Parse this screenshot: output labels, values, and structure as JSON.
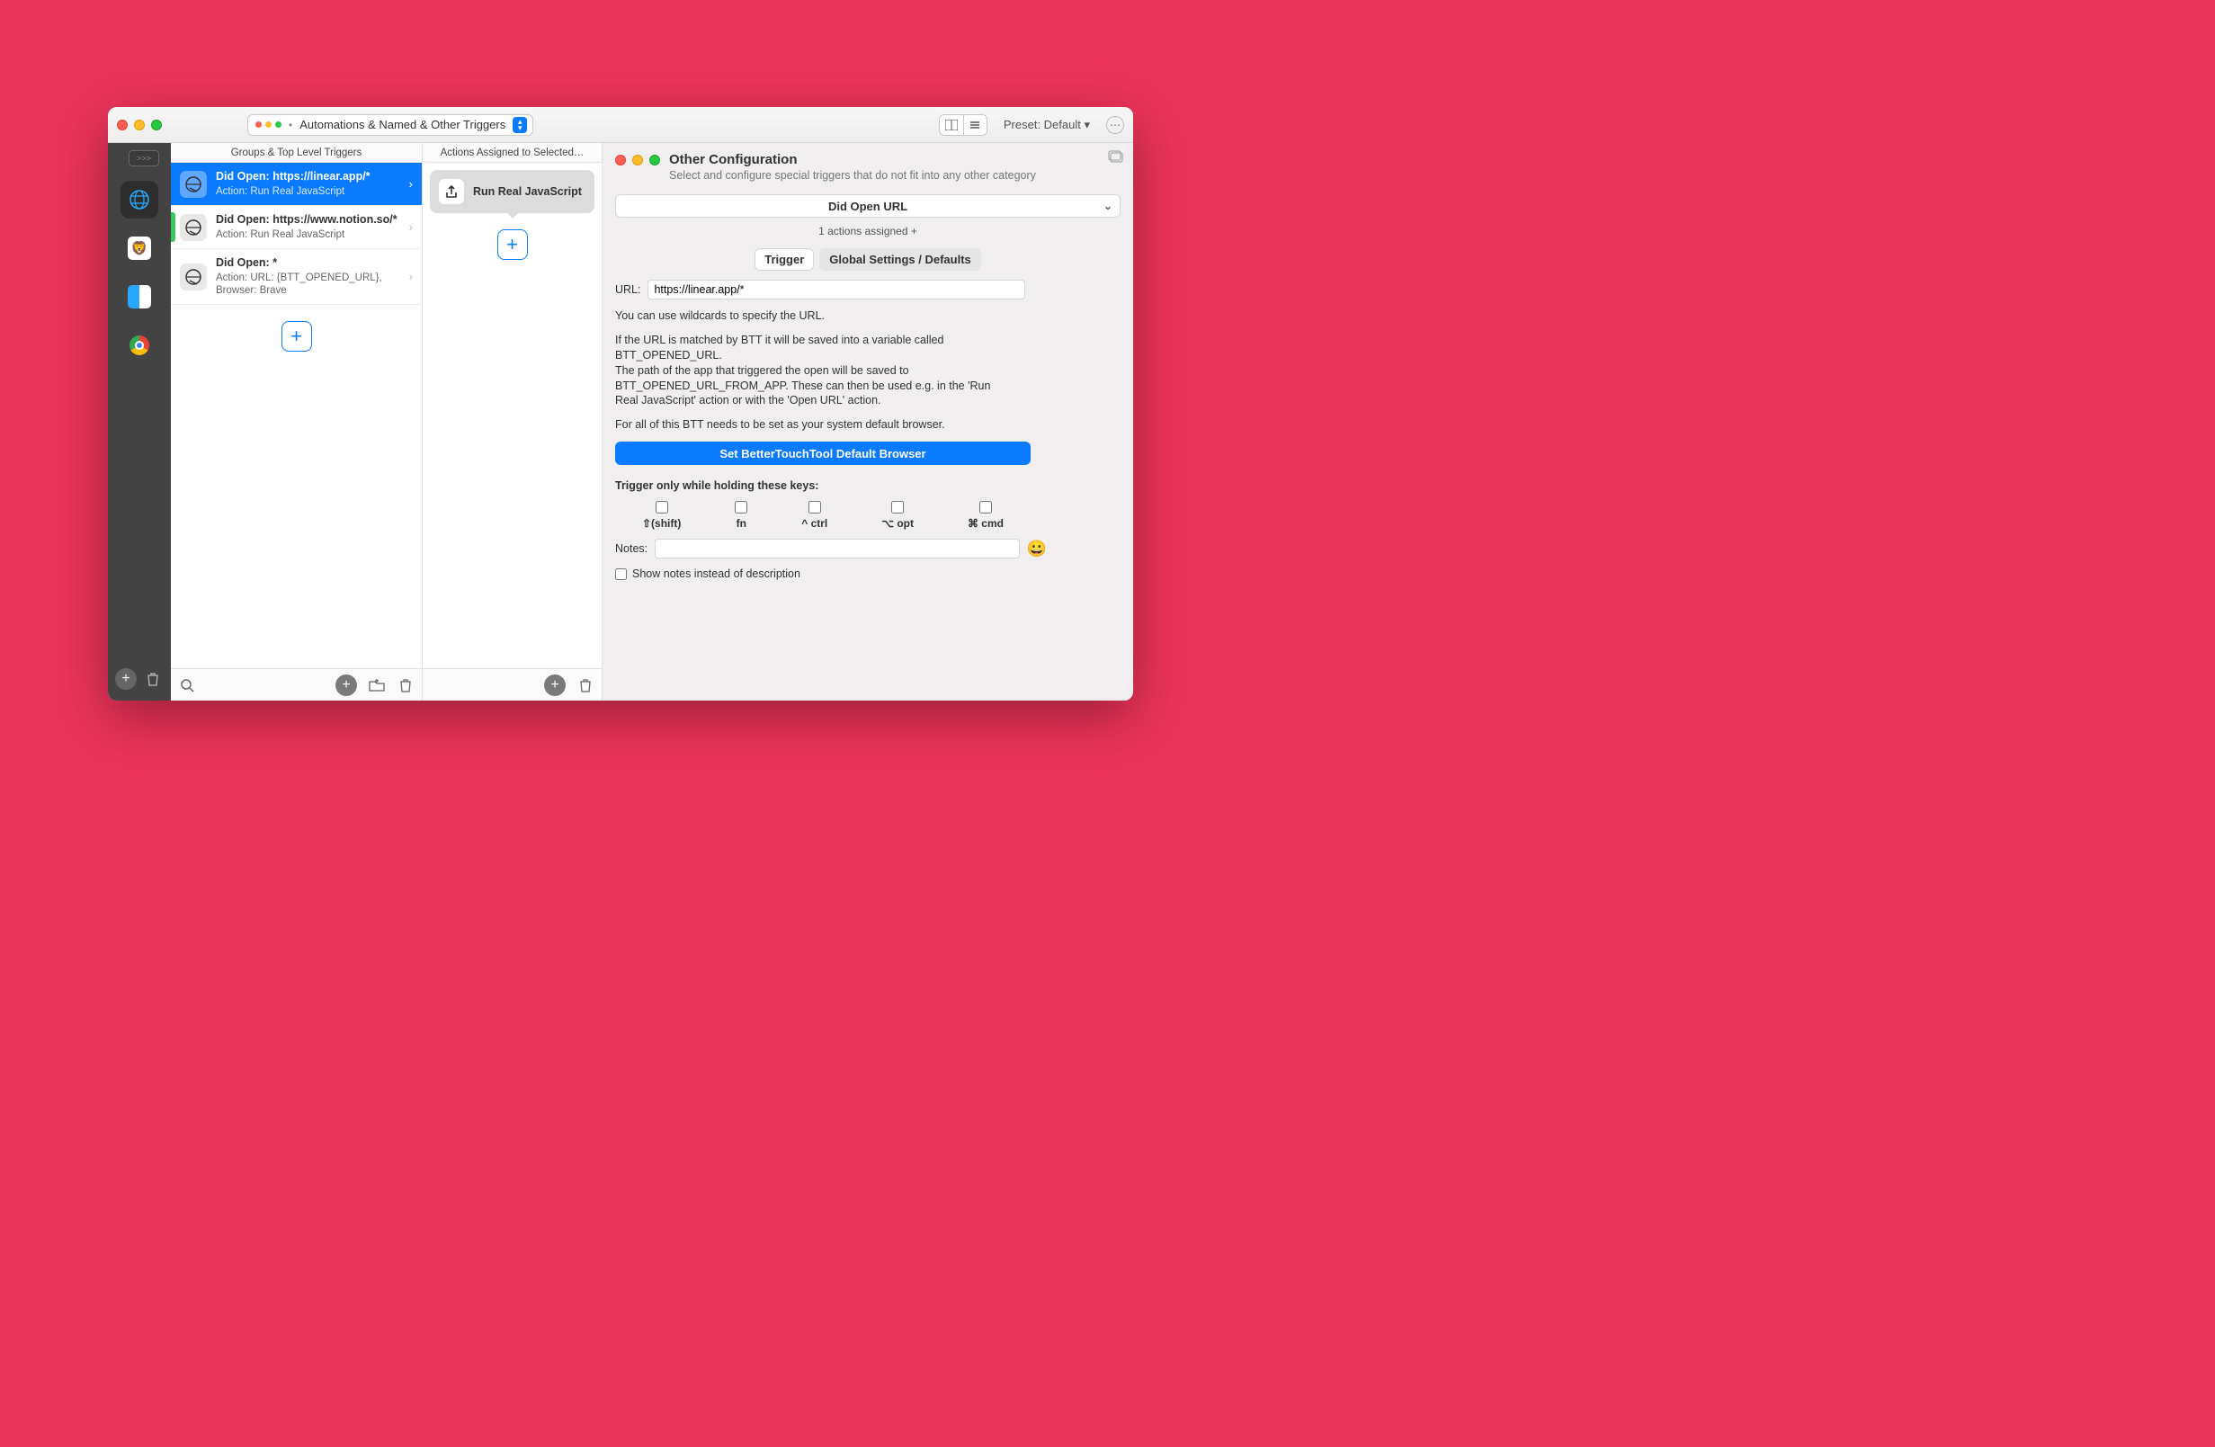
{
  "titlebar": {
    "context_label": "Automations & Named & Other Triggers",
    "preset_label": "Preset: Default ▾"
  },
  "sidebar": {
    "apps": [
      {
        "name": "global-globe",
        "selected": true
      },
      {
        "name": "brave"
      },
      {
        "name": "finder"
      },
      {
        "name": "chrome"
      }
    ]
  },
  "columns": {
    "triggers_header": "Groups & Top Level Triggers",
    "actions_header": "Actions Assigned to Selected…",
    "triggers": [
      {
        "title": "Did Open: https://linear.app/*",
        "sub": "Action: Run Real JavaScript",
        "selected": true
      },
      {
        "title": "Did Open: https://www.notion.so/*",
        "sub": "Action: Run Real JavaScript",
        "green": true
      },
      {
        "title": "Did Open: *",
        "sub": "Action: URL: {BTT_OPENED_URL}, Browser: Brave"
      }
    ],
    "actions": [
      {
        "label": "Run Real JavaScript"
      }
    ]
  },
  "config": {
    "title": "Other Configuration",
    "subtitle": "Select and configure special triggers that do not  fit into any other category",
    "select_value": "Did Open URL",
    "actions_line": "1 actions assigned +",
    "tabs": {
      "trigger": "Trigger",
      "globals": "Global Settings / Defaults"
    },
    "url_label": "URL:",
    "url_value": "https://linear.app/*",
    "explain1": "You can use wildcards to specify the URL.",
    "explain2": "If the URL is matched by BTT it will be saved into a variable called BTT_OPENED_URL.",
    "explain3": "The path of the app that triggered the open will be saved to BTT_OPENED_URL_FROM_APP. These can then be used e.g. in the 'Run Real JavaScript' action or with the 'Open URL' action.",
    "explain4": "For all of this BTT needs to be set as your system default browser.",
    "default_browser_btn": "Set BetterTouchTool Default Browser",
    "keys_title": "Trigger only while holding these keys:",
    "keys": {
      "shift": "⇧(shift)",
      "fn": "fn",
      "ctrl": "^ ctrl",
      "opt": "⌥ opt",
      "cmd": "⌘ cmd"
    },
    "notes_label": "Notes:",
    "show_notes_label": "Show notes instead of description"
  }
}
